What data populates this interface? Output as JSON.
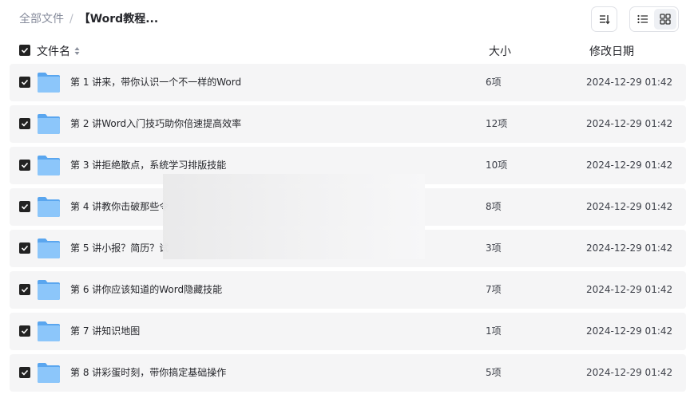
{
  "breadcrumb": {
    "root": "全部文件",
    "separator": "/",
    "current": "【Word教程..."
  },
  "toolbar": {
    "sort_icon": "sort-icon",
    "view_list_icon": "list-view-icon",
    "view_grid_icon": "grid-view-icon",
    "active_view": "list"
  },
  "table": {
    "headers": {
      "name": "文件名",
      "size": "大小",
      "modified": "修改日期"
    },
    "rows": [
      {
        "name": "第 1 讲来，带你认识一个不一样的Word",
        "size": "6项",
        "modified": "2024-12-29 01:42",
        "checked": true
      },
      {
        "name": "第 2 讲Word入门技巧助你倍速提高效率",
        "size": "12项",
        "modified": "2024-12-29 01:42",
        "checked": true
      },
      {
        "name": "第 3 讲拒绝散点，系统学习排版技能",
        "size": "10项",
        "modified": "2024-12-29 01:42",
        "checked": true
      },
      {
        "name": "第 4 讲教你击破那些令",
        "size": "8项",
        "modified": "2024-12-29 01:42",
        "checked": true
      },
      {
        "name": "第 5 讲小报？简历？试",
        "size": "3项",
        "modified": "2024-12-29 01:42",
        "checked": true
      },
      {
        "name": "第 6 讲你应该知道的Word隐藏技能",
        "size": "7项",
        "modified": "2024-12-29 01:42",
        "checked": true
      },
      {
        "name": "第 7 讲知识地图",
        "size": "1项",
        "modified": "2024-12-29 01:42",
        "checked": true
      },
      {
        "name": "第 8 讲彩蛋时刻，带你搞定基础操作",
        "size": "5项",
        "modified": "2024-12-29 01:42",
        "checked": true
      }
    ]
  },
  "colors": {
    "folder": "#6fb4f5",
    "row_bg": "#f5f5f6",
    "checkbox": "#222222"
  }
}
